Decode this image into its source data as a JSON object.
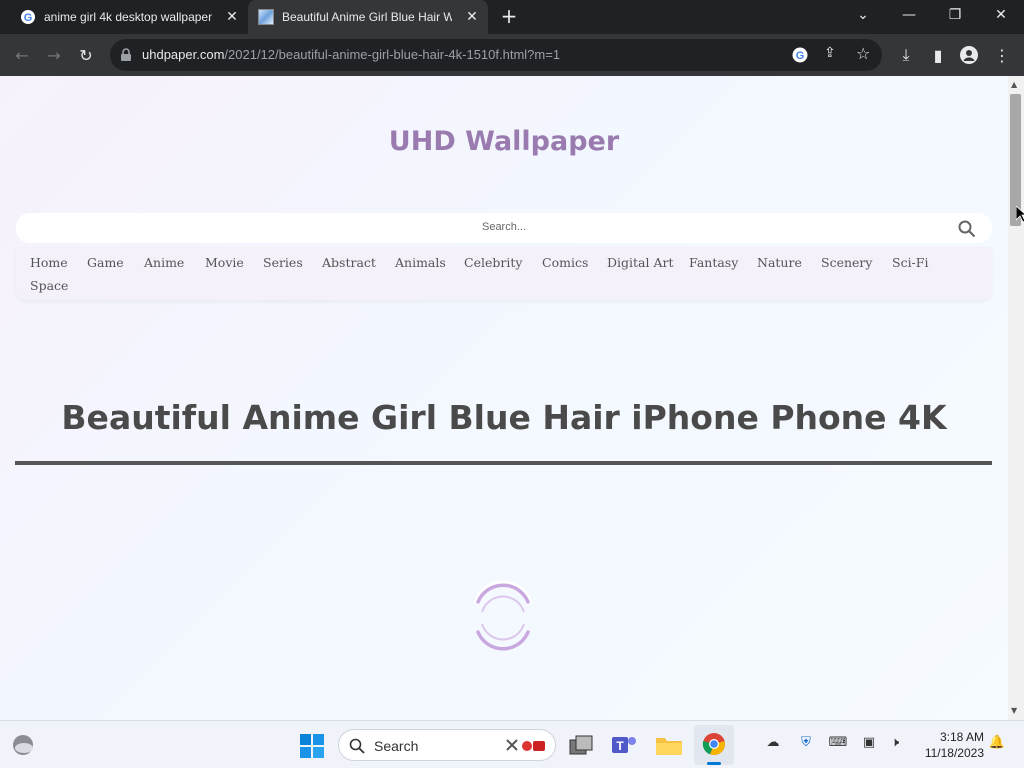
{
  "browser": {
    "tabs": [
      {
        "title": "anime girl 4k desktop wallpaper",
        "active": false
      },
      {
        "title": "Beautiful Anime Girl Blue Hair W",
        "active": true
      }
    ],
    "url_host": "uhdpaper.com",
    "url_path": "/2021/12/beautiful-anime-girl-blue-hair-4k-1510f.html?m=1"
  },
  "site": {
    "title": "UHD Wallpaper",
    "search_placeholder": "Search...",
    "menu": [
      "Home",
      "Game",
      "Anime",
      "Movie",
      "Series",
      "Abstract",
      "Animals",
      "Celebrity",
      "Comics",
      "Digital Art",
      "Fantasy",
      "Nature",
      "Scenery",
      "Sci-Fi",
      "Space"
    ],
    "heading": "Beautiful Anime Girl Blue Hair iPhone Phone 4K"
  },
  "taskbar": {
    "search_label": "Search",
    "time": "3:18 AM",
    "date": "11/18/2023"
  },
  "colors": {
    "site_title": "#9a7bb0",
    "spinner": "#c9a8e0",
    "tab_active": "#35363a"
  }
}
